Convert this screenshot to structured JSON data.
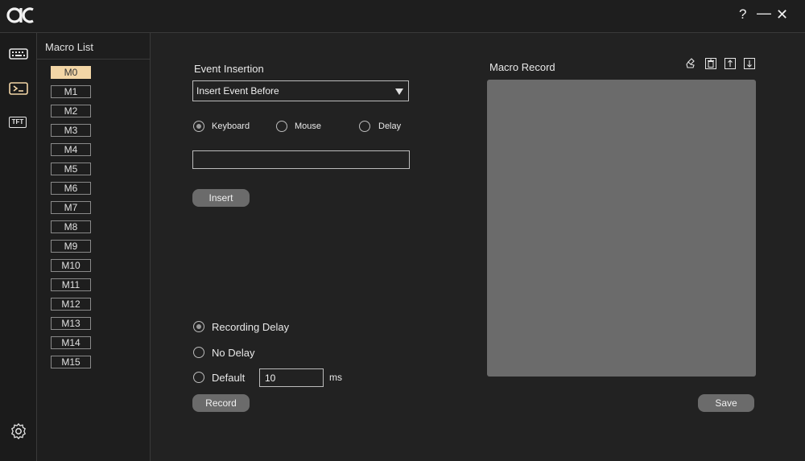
{
  "window": {
    "logo": "oic-logo",
    "help_label": "?",
    "minimize_label": "—",
    "close_label": "✕"
  },
  "sidebar": {
    "items": [
      {
        "icon": "keyboard-icon",
        "active": false
      },
      {
        "icon": "terminal-icon",
        "active": true
      },
      {
        "icon": "tft-icon",
        "active": false
      }
    ],
    "tft_label": "TFT",
    "settings_icon": "gear-icon"
  },
  "macro_list": {
    "title": "Macro List",
    "items": [
      "M0",
      "M1",
      "M2",
      "M3",
      "M4",
      "M5",
      "M6",
      "M7",
      "M8",
      "M9",
      "M10",
      "M11",
      "M12",
      "M13",
      "M14",
      "M15"
    ],
    "selected": "M0"
  },
  "event_insertion": {
    "title": "Event Insertion",
    "select_value": "Insert Event Before",
    "types": [
      "Keyboard",
      "Mouse",
      "Delay"
    ],
    "selected_type": "Keyboard",
    "input_value": "",
    "insert_label": "Insert"
  },
  "recording": {
    "options": [
      "Recording Delay",
      "No Delay",
      "Default"
    ],
    "selected": "Recording Delay",
    "default_value": "10",
    "unit": "ms",
    "record_label": "Record"
  },
  "macro_record": {
    "title": "Macro Record",
    "tools": [
      "clear-icon",
      "trash-icon",
      "move-up-icon",
      "move-down-icon"
    ],
    "save_label": "Save"
  },
  "colors": {
    "background": "#222222",
    "selected_item": "#f3d6a6",
    "button": "#6b6b6b",
    "record_area": "#6b6b6b"
  }
}
